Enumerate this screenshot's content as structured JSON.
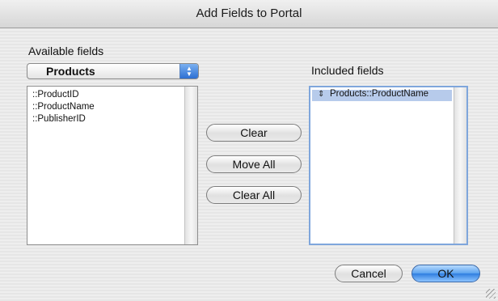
{
  "window": {
    "title": "Add Fields to Portal"
  },
  "available": {
    "label": "Available fields",
    "table_select": "Products",
    "fields": [
      "::ProductID",
      "::ProductName",
      "::PublisherID"
    ]
  },
  "included": {
    "label": "Included fields",
    "fields": [
      "Products::ProductName"
    ]
  },
  "buttons": {
    "clear": "Clear",
    "move_all": "Move All",
    "clear_all": "Clear All",
    "cancel": "Cancel",
    "ok": "OK"
  },
  "colors": {
    "selection": "#b7cbeb",
    "default_button": "#5aa1ee"
  }
}
